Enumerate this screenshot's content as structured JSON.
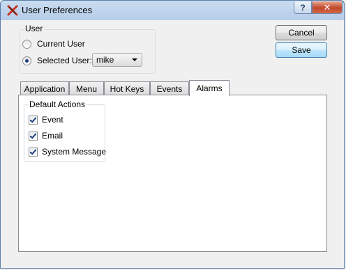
{
  "window": {
    "title": "User Preferences",
    "help_button": "?",
    "close_button": "✕"
  },
  "user_group": {
    "label": "User",
    "current_user_label": "Current User",
    "selected_user_label": "Selected User:",
    "selected_option": "selected_user",
    "selected_user_value": "mike"
  },
  "buttons": {
    "cancel": "Cancel",
    "save": "Save"
  },
  "tabs": [
    {
      "label": "Application",
      "active": false
    },
    {
      "label": "Menu",
      "active": false
    },
    {
      "label": "Hot Keys",
      "active": false
    },
    {
      "label": "Events",
      "active": false
    },
    {
      "label": "Alarms",
      "active": true
    }
  ],
  "default_actions": {
    "label": "Default Actions",
    "items": [
      {
        "label": "Event",
        "checked": true
      },
      {
        "label": "Email",
        "checked": true
      },
      {
        "label": "System Message",
        "checked": true
      }
    ]
  },
  "colors": {
    "close_button": "#c0462a",
    "accent_check": "#1c3e7a"
  }
}
